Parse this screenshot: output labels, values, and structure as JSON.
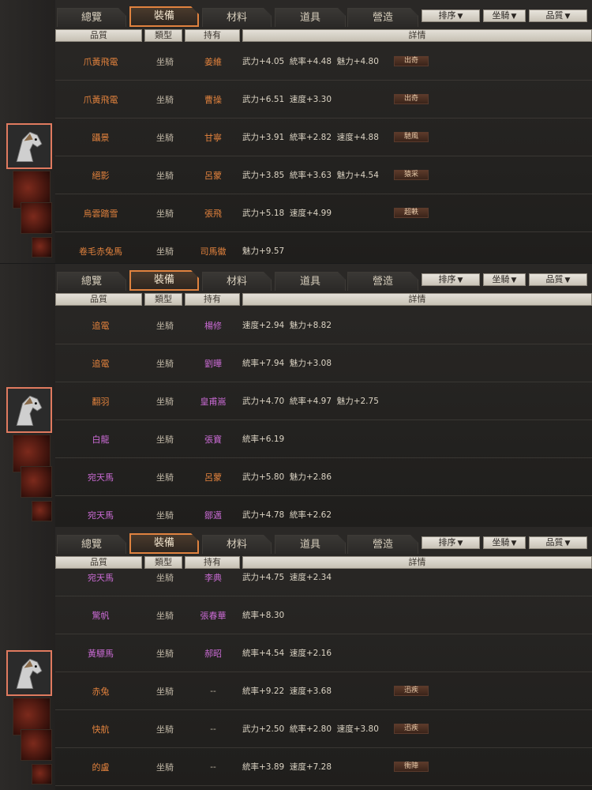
{
  "tabs": [
    "總覽",
    "裝備",
    "材料",
    "道具",
    "營造"
  ],
  "filters": [
    {
      "label": "排序",
      "arrow": "▼"
    },
    {
      "label": "坐騎",
      "arrow": "▼"
    },
    {
      "label": "品質",
      "arrow": "▼"
    }
  ],
  "columns": [
    "品質",
    "類型",
    "持有",
    "詳情"
  ],
  "panels": [
    {
      "rows": [
        {
          "name": "爪黃飛電",
          "name_color": "orange",
          "type": "坐騎",
          "owner": "姜維",
          "owner_color": "orange",
          "detail": "武力+4.05  統率+4.48  魅力+4.80",
          "skill": "出奇"
        },
        {
          "name": "爪黃飛電",
          "name_color": "orange",
          "type": "坐騎",
          "owner": "曹操",
          "owner_color": "orange",
          "detail": "武力+6.51  速度+3.30",
          "skill": "出奇"
        },
        {
          "name": "躡景",
          "name_color": "orange",
          "type": "坐騎",
          "owner": "甘寧",
          "owner_color": "orange",
          "detail": "武力+3.91  統率+2.82  速度+4.88",
          "skill": "馳風"
        },
        {
          "name": "絕影",
          "name_color": "orange",
          "type": "坐騎",
          "owner": "呂蒙",
          "owner_color": "orange",
          "detail": "武力+3.85  統率+3.63  魅力+4.54",
          "skill": "猿采"
        },
        {
          "name": "烏雲踏雪",
          "name_color": "orange",
          "type": "坐騎",
          "owner": "張飛",
          "owner_color": "orange",
          "detail": "武力+5.18  速度+4.99",
          "skill": "超軼"
        },
        {
          "name": "卷毛赤兔馬",
          "name_color": "orange",
          "type": "坐騎",
          "owner": "司馬徽",
          "owner_color": "orange",
          "detail": "魅力+9.57",
          "skill": ""
        }
      ]
    },
    {
      "rows": [
        {
          "name": "追電",
          "name_color": "orange",
          "type": "坐騎",
          "owner": "楊修",
          "owner_color": "purple",
          "detail": "速度+2.94  魅力+8.82",
          "skill": ""
        },
        {
          "name": "追電",
          "name_color": "orange",
          "type": "坐騎",
          "owner": "劉曄",
          "owner_color": "purple",
          "detail": "統率+7.94  魅力+3.08",
          "skill": ""
        },
        {
          "name": "翻羽",
          "name_color": "orange",
          "type": "坐騎",
          "owner": "皇甫嵩",
          "owner_color": "purple",
          "detail": "武力+4.70  統率+4.97  魅力+2.75",
          "skill": ""
        },
        {
          "name": "白龍",
          "name_color": "purple",
          "type": "坐騎",
          "owner": "張寶",
          "owner_color": "purple",
          "detail": "統率+6.19",
          "skill": ""
        },
        {
          "name": "宛天馬",
          "name_color": "purple",
          "type": "坐騎",
          "owner": "呂蒙",
          "owner_color": "orange",
          "detail": "武力+5.80  魅力+2.86",
          "skill": ""
        },
        {
          "name": "宛天馬",
          "name_color": "purple",
          "type": "坐騎",
          "owner": "鄒邁",
          "owner_color": "purple",
          "detail": "武力+4.78  統率+2.62",
          "skill": ""
        }
      ]
    },
    {
      "rows": [
        {
          "name": "宛天馬",
          "name_color": "purple",
          "type": "坐騎",
          "owner": "李典",
          "owner_color": "purple",
          "detail": "武力+4.75  速度+2.34",
          "skill": ""
        },
        {
          "name": "驚帆",
          "name_color": "purple",
          "type": "坐騎",
          "owner": "張春華",
          "owner_color": "purple",
          "detail": "統率+8.30",
          "skill": ""
        },
        {
          "name": "黃驃馬",
          "name_color": "purple",
          "type": "坐騎",
          "owner": "郝昭",
          "owner_color": "purple",
          "detail": "統率+4.54  速度+2.16",
          "skill": ""
        },
        {
          "name": "赤兔",
          "name_color": "orange",
          "type": "坐騎",
          "owner": "--",
          "owner_color": "gray",
          "detail": "統率+9.22  速度+3.68",
          "skill": "迅疾"
        },
        {
          "name": "快航",
          "name_color": "orange",
          "type": "坐騎",
          "owner": "--",
          "owner_color": "gray",
          "detail": "武力+2.50  統率+2.80  速度+3.80",
          "skill": "迅疾"
        },
        {
          "name": "的盧",
          "name_color": "orange",
          "type": "坐騎",
          "owner": "--",
          "owner_color": "gray",
          "detail": "統率+3.89  速度+7.28",
          "skill": "衝陣"
        }
      ]
    }
  ],
  "active_tab_index": 1,
  "selected_slot_index": 0
}
